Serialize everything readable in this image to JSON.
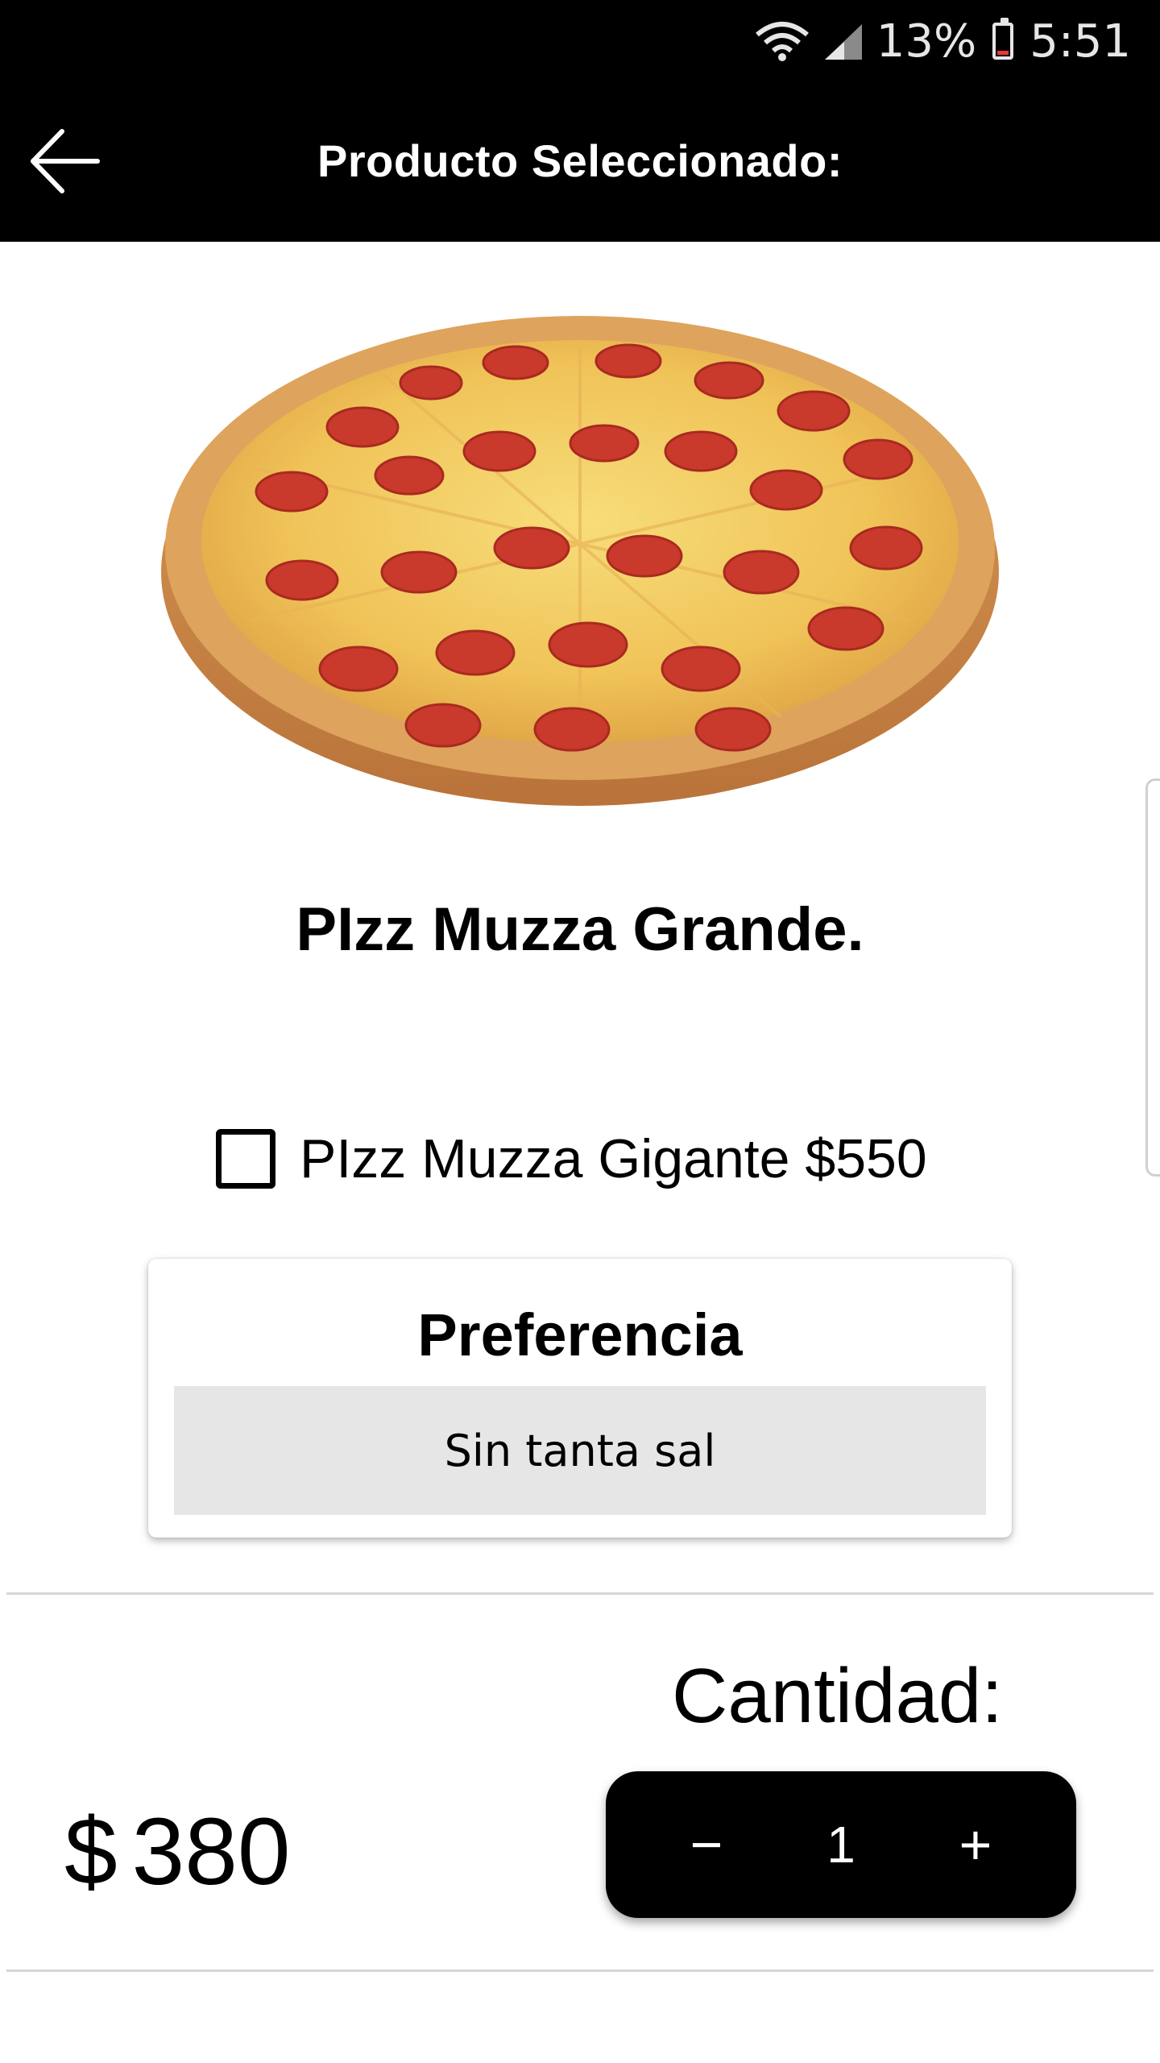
{
  "status_bar": {
    "battery": "13%",
    "time": "5:51"
  },
  "app_bar": {
    "title": "Producto Seleccionado:",
    "back_icon": "arrow-left-icon"
  },
  "product": {
    "image": "pepperoni-pizza",
    "name": "PIzz Muzza Grande.",
    "price_symbol": "$",
    "price_value": "380"
  },
  "option": {
    "label": "PIzz Muzza Gigante $550",
    "checked": false
  },
  "preference": {
    "title": "Preferencia",
    "value": "Sin tanta sal"
  },
  "quantity": {
    "label": "Cantidad:",
    "decrement": "−",
    "value": "1",
    "increment": "+"
  }
}
